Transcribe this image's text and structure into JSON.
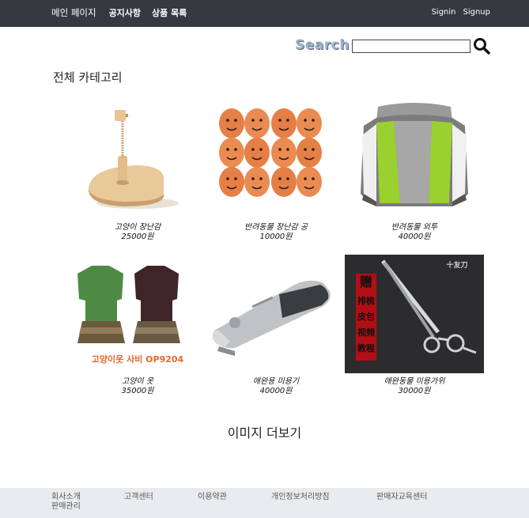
{
  "nav": {
    "brand": "메인 페이지",
    "links": [
      "공지사항",
      "상품 목록"
    ],
    "signin": "Signin",
    "signup": "Signup"
  },
  "search": {
    "label": "Search",
    "value": "",
    "icon": "search-icon"
  },
  "category_title": "전체 카테고리",
  "products": [
    {
      "name": "고양이 장난감",
      "price": "25000원",
      "image": "wooden-cat-toy"
    },
    {
      "name": "반려동물 장난감 공",
      "price": "10000원",
      "image": "egg-face-balls"
    },
    {
      "name": "반려동물 외투",
      "price": "40000원",
      "image": "pet-jacket"
    },
    {
      "name": "고양이 옷",
      "price": "35000원",
      "image": "cat-dresses",
      "image_caption": "고양이옷 사비 OP9204"
    },
    {
      "name": "애완용 미용기",
      "price": "40000원",
      "image": "pet-clipper"
    },
    {
      "name": "애완동물 미용가위",
      "price": "30000원",
      "image": "grooming-scissors",
      "image_caption_lines": [
        "赠",
        "排梳",
        "皮包",
        "视频",
        "教程"
      ]
    }
  ],
  "more_button": "이미지 더보기",
  "footer": {
    "links": [
      "회사소개",
      "판매관리",
      "고객센터",
      "이용약관",
      "개인정보처리방침",
      "판매자교육센터"
    ]
  },
  "colors": {
    "navbar": "#343a40",
    "footer": "#e9ecef",
    "search_label": "#9fb3cf"
  }
}
